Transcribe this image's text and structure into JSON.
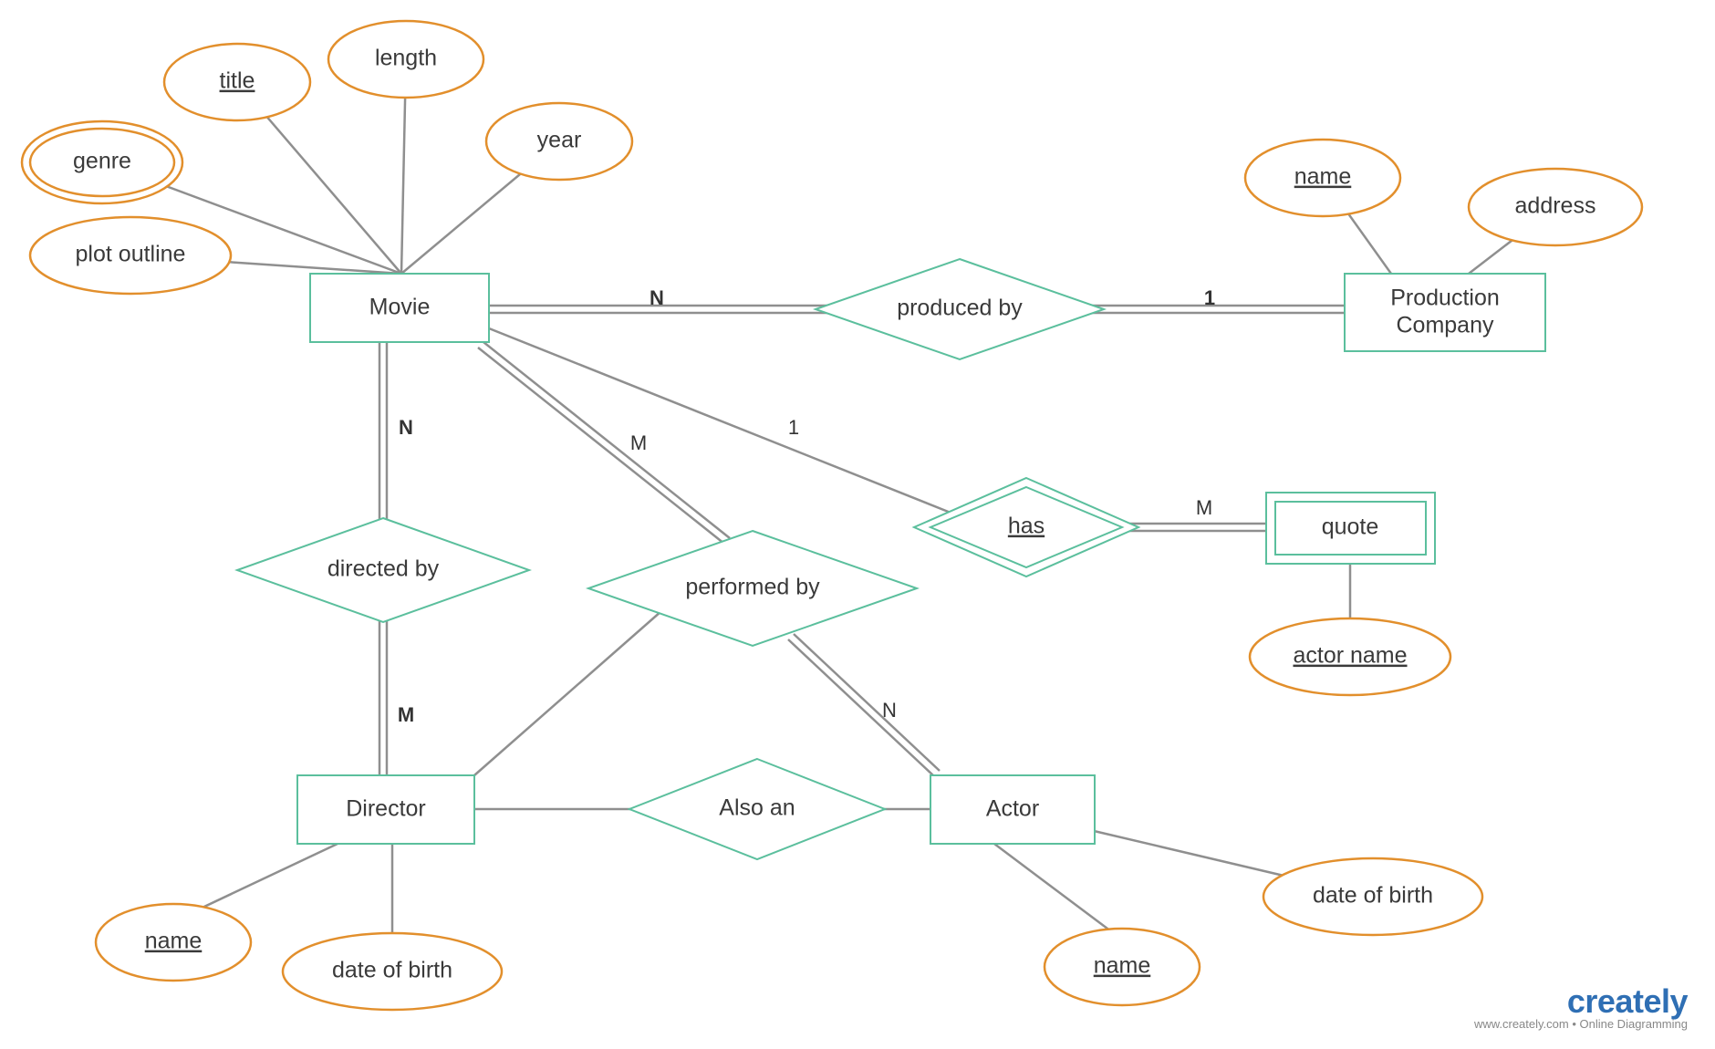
{
  "diagram_type": "Entity-Relationship Diagram",
  "entities": {
    "movie": {
      "label": "Movie"
    },
    "production_company": {
      "label_line1": "Production",
      "label_line2": "Company"
    },
    "director": {
      "label": "Director"
    },
    "actor": {
      "label": "Actor"
    },
    "quote": {
      "label": "quote",
      "weak": true
    }
  },
  "relationships": {
    "produced_by": {
      "label": "produced by"
    },
    "directed_by": {
      "label": "directed by"
    },
    "performed_by": {
      "label": "performed by"
    },
    "also_an": {
      "label": "Also an"
    },
    "has": {
      "label": "has",
      "identifying": true
    }
  },
  "attributes": {
    "movie": {
      "title": {
        "label": "title",
        "key": true
      },
      "length": {
        "label": "length"
      },
      "year": {
        "label": "year"
      },
      "genre": {
        "label": "genre",
        "multivalued": true
      },
      "plot_outline": {
        "label": "plot outline"
      }
    },
    "production_company": {
      "name": {
        "label": "name",
        "key": true
      },
      "address": {
        "label": "address"
      }
    },
    "director": {
      "name": {
        "label": "name",
        "key": true
      },
      "dob": {
        "label": "date of birth"
      }
    },
    "actor": {
      "name": {
        "label": "name",
        "key": true
      },
      "dob": {
        "label": "date of birth"
      }
    },
    "quote": {
      "actor_name": {
        "label": "actor name",
        "key": true
      }
    }
  },
  "cardinalities": {
    "movie_produced_by": "N",
    "production_company_produced_by": "1",
    "movie_directed_by": "N",
    "director_directed_by": "M",
    "movie_performed_by": "M",
    "actor_performed_by": "N",
    "movie_has": "1",
    "quote_has": "M"
  },
  "watermark": {
    "brand_part1": "create",
    "brand_part2": "ly",
    "subtitle": "www.creately.com • Online Diagramming"
  }
}
